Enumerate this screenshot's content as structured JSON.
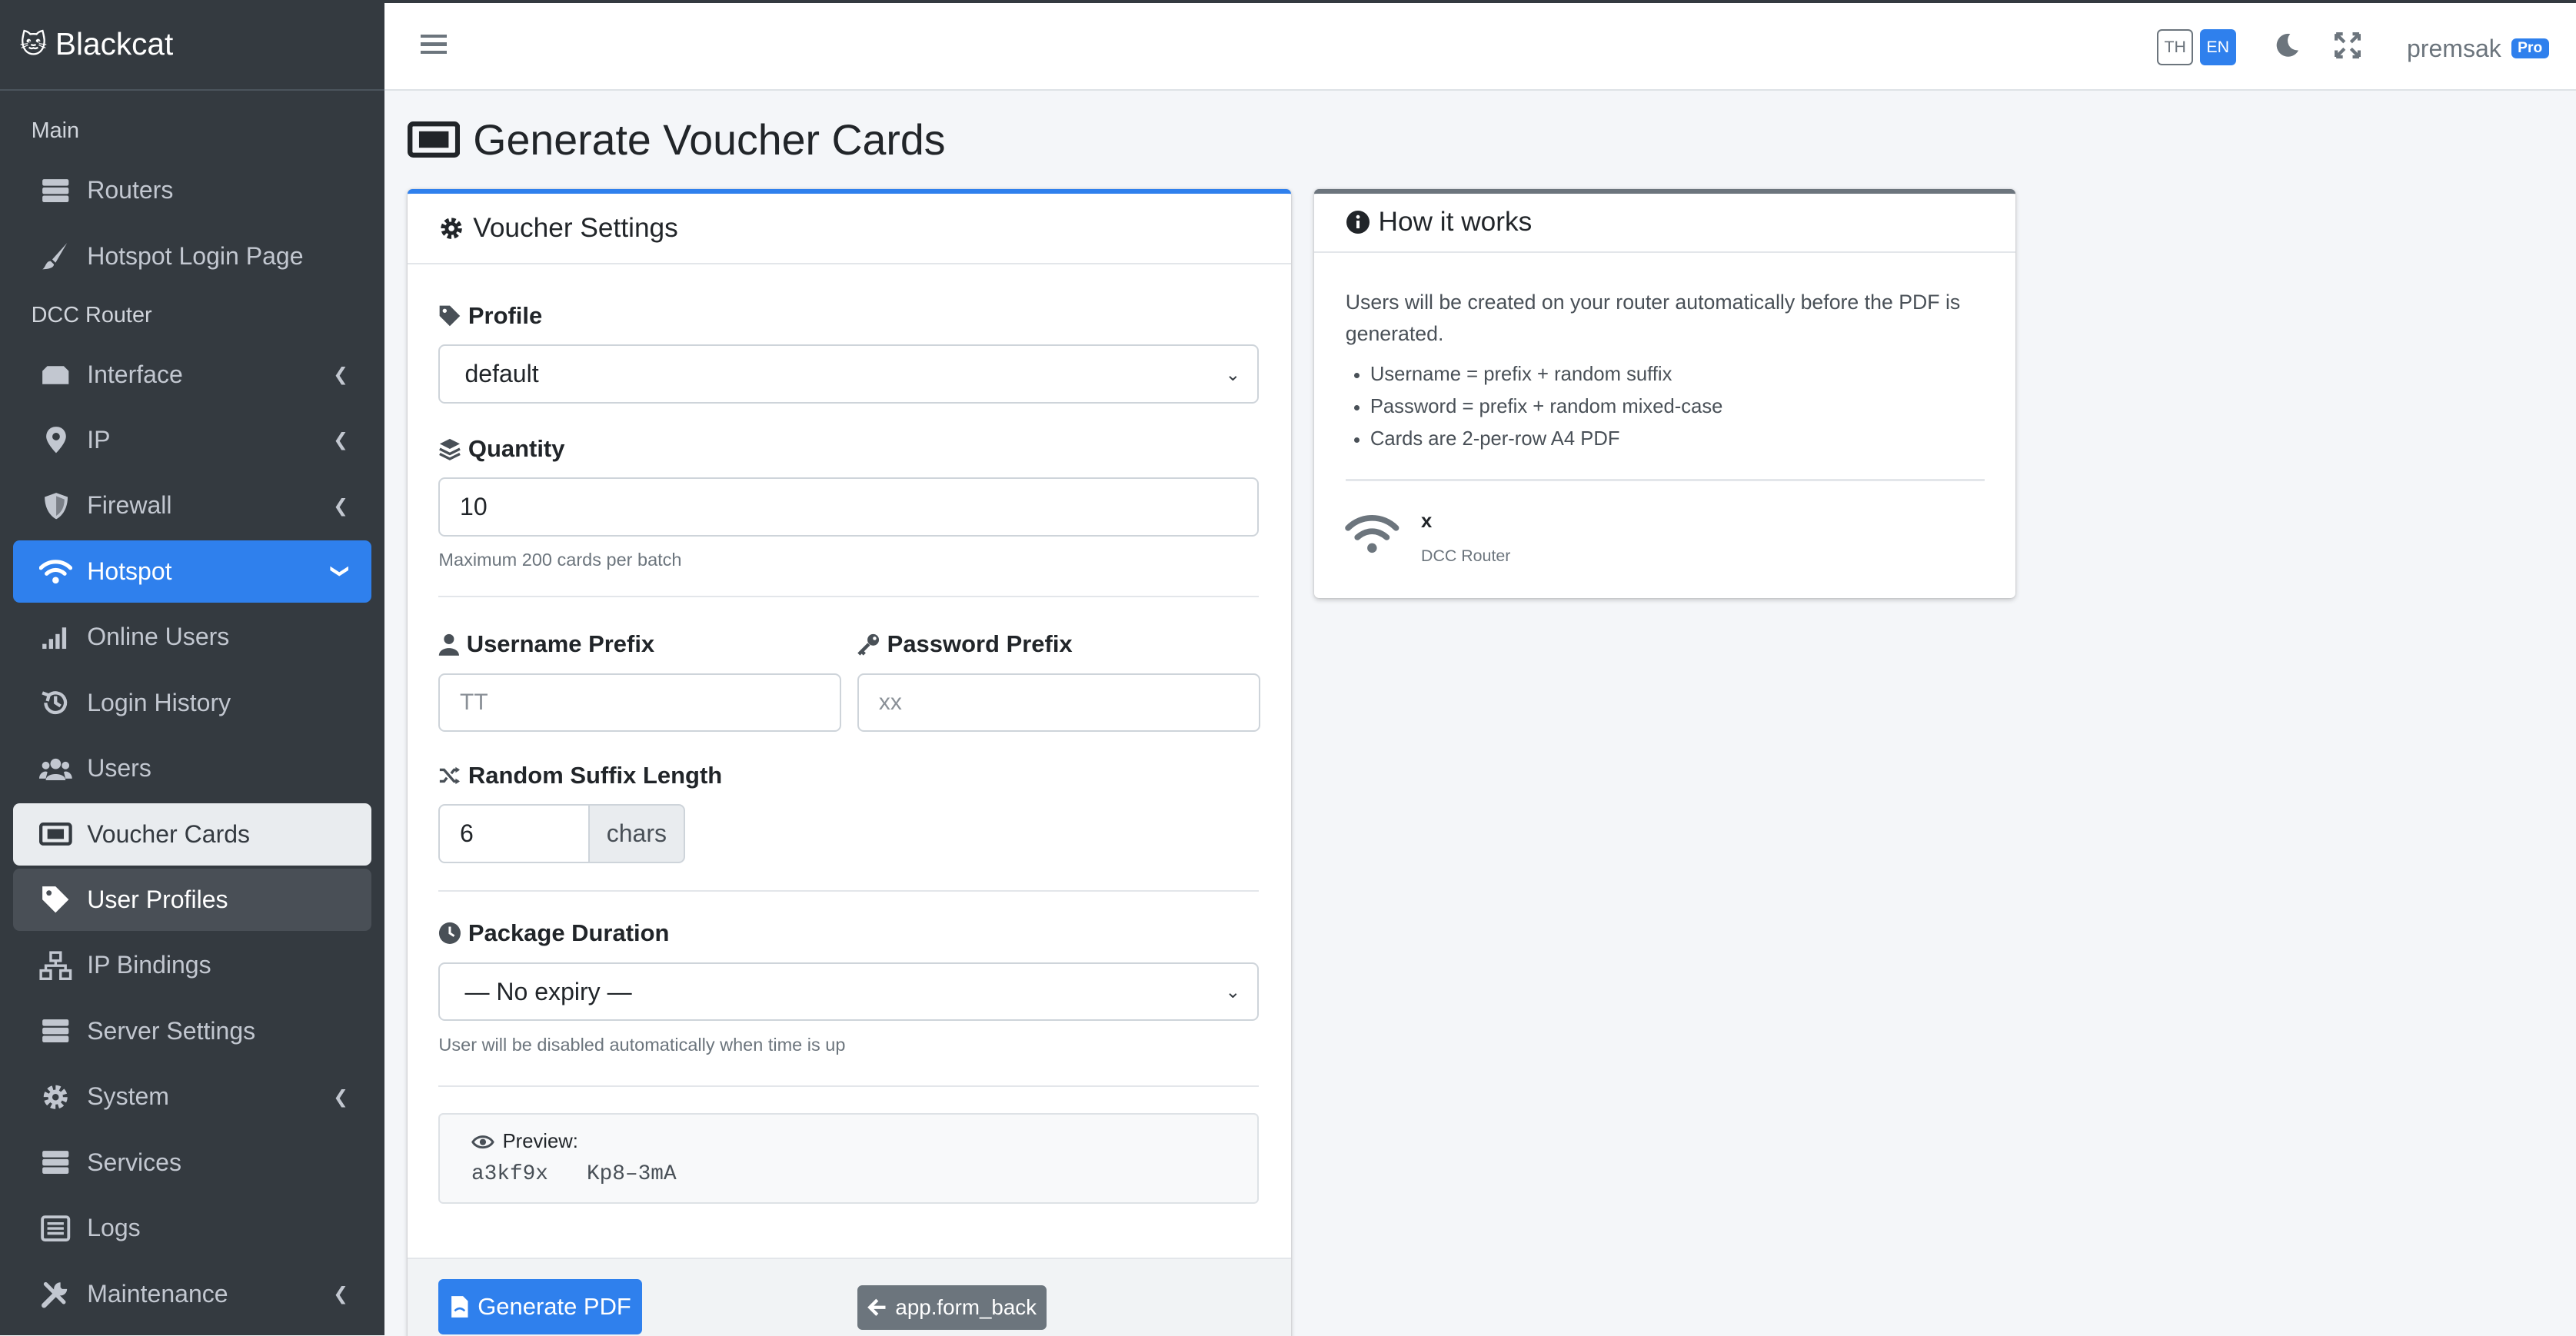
{
  "brand": {
    "logo": "🐱",
    "name": "Blackcat"
  },
  "sidebar": {
    "sections": {
      "main": "Main",
      "router": "DCC Router"
    },
    "items": [
      {
        "label": "Routers"
      },
      {
        "label": "Hotspot Login Page"
      },
      {
        "label": "Interface"
      },
      {
        "label": "IP"
      },
      {
        "label": "Firewall"
      },
      {
        "label": "Hotspot"
      },
      {
        "label": "Online Users"
      },
      {
        "label": "Login History"
      },
      {
        "label": "Users"
      },
      {
        "label": "Voucher Cards"
      },
      {
        "label": "User Profiles"
      },
      {
        "label": "IP Bindings"
      },
      {
        "label": "Server Settings"
      },
      {
        "label": "System"
      },
      {
        "label": "Services"
      },
      {
        "label": "Logs"
      },
      {
        "label": "Maintenance"
      }
    ]
  },
  "topbar": {
    "lang_th": "TH",
    "lang_en": "EN",
    "user": "premsak",
    "badge": "Pro"
  },
  "page": {
    "title": "Generate Voucher Cards"
  },
  "settings": {
    "title": "Voucher Settings",
    "profile": {
      "label": "Profile",
      "value": "default"
    },
    "quantity": {
      "label": "Quantity",
      "value": "10",
      "help": "Maximum 200 cards per batch"
    },
    "username_prefix": {
      "label": "Username Prefix",
      "placeholder": "TT"
    },
    "password_prefix": {
      "label": "Password Prefix",
      "placeholder": "xx"
    },
    "suffix": {
      "label": "Random Suffix Length",
      "value": "6",
      "unit": "chars"
    },
    "duration": {
      "label": "Package Duration",
      "value": "— No expiry —",
      "help": "User will be disabled automatically when time is up"
    },
    "preview": {
      "label": "Preview:",
      "username": "a3kf9x",
      "password": "Kp8–3mA"
    },
    "generate_button": "Generate PDF",
    "back_button": "app.form_back"
  },
  "how": {
    "title": "How it works",
    "intro": "Users will be created on your router automatically before the PDF is generated.",
    "bullets": [
      "Username = prefix + random suffix",
      "Password = prefix + random mixed-case",
      "Cards are 2-per-row A4 PDF"
    ],
    "hotspot_name": "x",
    "router_name": "DCC Router"
  },
  "colors": {
    "accent": "#2f80ed",
    "sidebar_bg": "#343a40",
    "secondary": "#6c757d"
  }
}
